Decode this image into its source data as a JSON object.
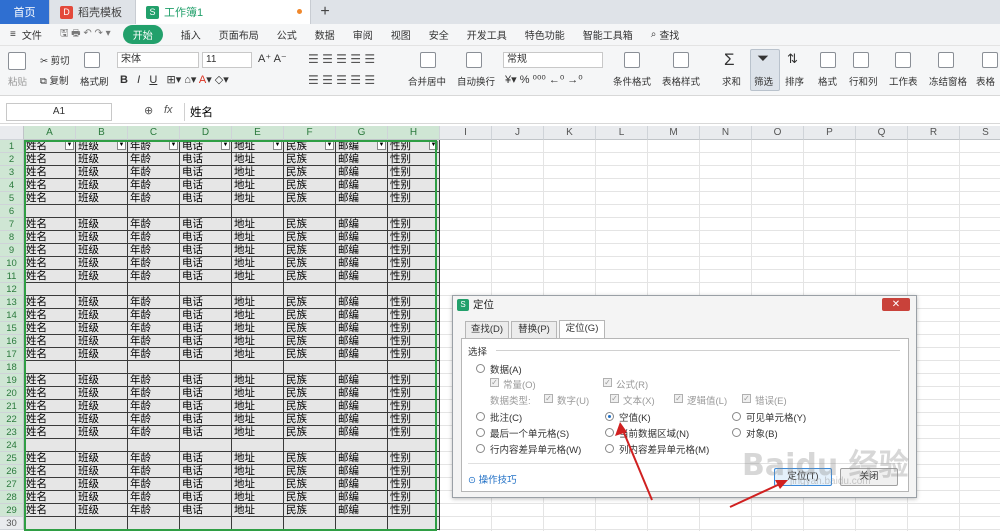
{
  "tabs": {
    "home": "首页",
    "template": "稻壳模板",
    "workbook": "工作簿1",
    "add": "+"
  },
  "menu": {
    "file": "文件",
    "start": "开始",
    "items": [
      "插入",
      "页面布局",
      "公式",
      "数据",
      "审阅",
      "视图",
      "安全",
      "开发工具",
      "特色功能",
      "智能工具箱"
    ],
    "search": "查找"
  },
  "ribbon": {
    "paste": "粘贴",
    "cut": "剪切",
    "copy": "复制",
    "format_painter": "格式刷",
    "font": "宋体",
    "size": "11",
    "merge": "合并居中",
    "wrap": "自动换行",
    "number_format": "常规",
    "cond_format": "条件格式",
    "table_style": "表格样式",
    "sum": "求和",
    "filter": "筛选",
    "sort": "排序",
    "format": "格式",
    "rowcol": "行和列",
    "worksheet": "工作表",
    "freeze": "冻结窗格",
    "table_tool": "表格"
  },
  "formula": {
    "cell_ref": "A1",
    "fx": "fx",
    "value": "姓名"
  },
  "columns": [
    "A",
    "B",
    "C",
    "D",
    "E",
    "F",
    "G",
    "H",
    "I",
    "J",
    "K",
    "L",
    "M",
    "N",
    "O",
    "P",
    "Q",
    "R",
    "S"
  ],
  "rows": [
    "1",
    "2",
    "3",
    "4",
    "5",
    "6",
    "7",
    "8",
    "9",
    "10",
    "11",
    "12",
    "13",
    "14",
    "15",
    "16",
    "17",
    "18",
    "19",
    "20",
    "21",
    "22",
    "23",
    "24",
    "25",
    "26",
    "27",
    "28",
    "29",
    "30"
  ],
  "headers": [
    "姓名",
    "班级",
    "年龄",
    "电话",
    "地址",
    "民族",
    "邮编",
    "性别"
  ],
  "dialog": {
    "title": "定位",
    "close": "✕",
    "tabs": [
      "查找(D)",
      "替换(P)",
      "定位(G)"
    ],
    "section": "选择",
    "data": "数据(A)",
    "const": "常量(O)",
    "formula": "公式(R)",
    "datatype": "数据类型:",
    "num": "数字(U)",
    "text": "文本(X)",
    "logic": "逻辑值(L)",
    "err": "错误(E)",
    "comment": "批注(C)",
    "blank": "空值(K)",
    "visible": "可见单元格(Y)",
    "lastcell": "最后一个单元格(S)",
    "region": "当前数据区域(N)",
    "object": "对象(B)",
    "rowdiff": "行内容差异单元格(W)",
    "coldiff": "列内容差异单元格(M)",
    "tips": "操作技巧",
    "ok": "定位(T)",
    "cancel": "关闭"
  },
  "watermark": {
    "main": "Baidu 经验",
    "sub": "jingyan.baidu.com"
  },
  "colors": {
    "accent": "#22a06b",
    "selection": "#2f9e44",
    "arrow": "#d02020"
  }
}
